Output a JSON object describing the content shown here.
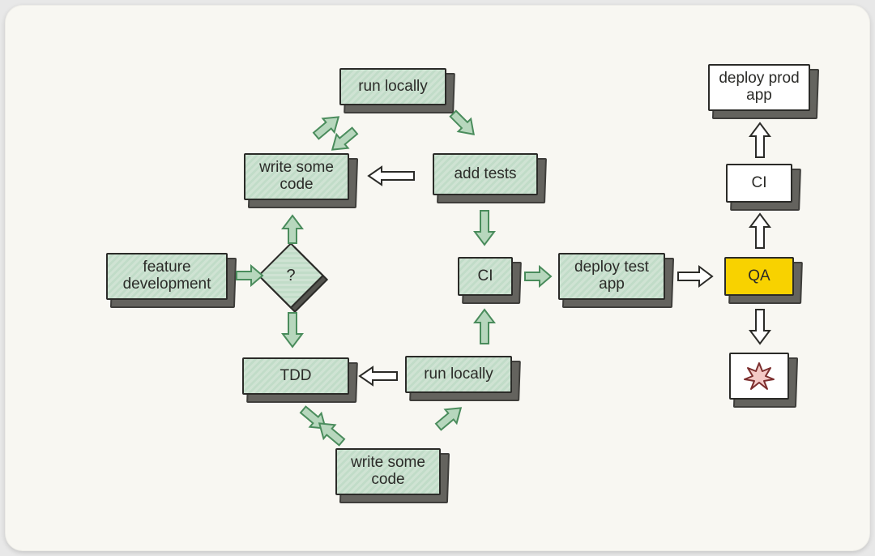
{
  "nodes": {
    "feature_dev": {
      "label": "feature development",
      "fill": "green"
    },
    "decision": {
      "label": "?",
      "fill": "green"
    },
    "write_code_top": {
      "label": "write some code",
      "fill": "green"
    },
    "run_local_top": {
      "label": "run locally",
      "fill": "green"
    },
    "add_tests": {
      "label": "add tests",
      "fill": "green"
    },
    "ci_green": {
      "label": "CI",
      "fill": "green"
    },
    "run_local_bot": {
      "label": "run locally",
      "fill": "green"
    },
    "tdd": {
      "label": "TDD",
      "fill": "green"
    },
    "write_code_bot": {
      "label": "write some code",
      "fill": "green"
    },
    "deploy_test": {
      "label": "deploy test app",
      "fill": "green"
    },
    "qa": {
      "label": "QA",
      "fill": "yellow"
    },
    "ci_white": {
      "label": "CI",
      "fill": "white"
    },
    "deploy_prod": {
      "label": "deploy prod app",
      "fill": "white"
    },
    "bug": {
      "label": "bug",
      "fill": "white"
    }
  },
  "arrows": {
    "feat_to_decision": {
      "color": "green"
    },
    "decision_to_write_top": {
      "color": "green"
    },
    "write_top_to_run_top_a": {
      "color": "green"
    },
    "write_top_to_run_top_b": {
      "color": "green"
    },
    "run_top_to_add_tests": {
      "color": "green"
    },
    "add_tests_to_write_top": {
      "color": "white"
    },
    "add_tests_to_ci": {
      "color": "green"
    },
    "ci_to_deploy_test": {
      "color": "green"
    },
    "run_bot_to_ci": {
      "color": "green"
    },
    "run_bot_to_tdd": {
      "color": "white"
    },
    "decision_to_tdd": {
      "color": "green"
    },
    "tdd_to_write_bot_a": {
      "color": "green"
    },
    "tdd_to_write_bot_b": {
      "color": "green"
    },
    "write_bot_to_run_bot": {
      "color": "green"
    },
    "deploy_test_to_qa": {
      "color": "white"
    },
    "qa_to_ci_white": {
      "color": "white"
    },
    "ci_white_to_deploy_prod": {
      "color": "white"
    },
    "qa_to_bug": {
      "color": "white"
    }
  }
}
